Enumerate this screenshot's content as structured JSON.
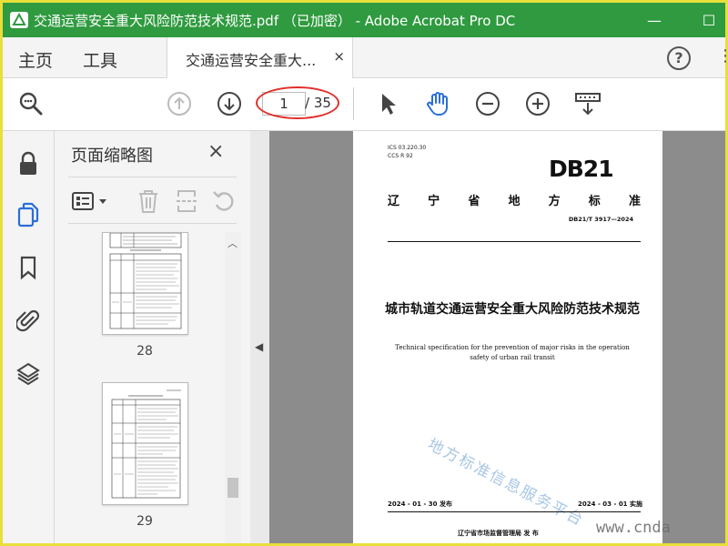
{
  "window": {
    "title": "交通运营安全重大风险防范技术规范.pdf （已加密） - Adobe Acrobat Pro DC",
    "minimize": "—",
    "maximize": "☐"
  },
  "menubar": {
    "home": "主页",
    "tools": "工具",
    "doc_tab": "交通运营安全重大...",
    "doc_tab_close": "×",
    "help": "?"
  },
  "toolbar": {
    "page_current": "1",
    "page_total": "/ 35"
  },
  "thumbnails": {
    "panel_title": "页面缩略图",
    "close": "×",
    "pages": [
      {
        "label": "28"
      },
      {
        "label": "29"
      }
    ]
  },
  "document": {
    "ics": "ICS  03.220.30",
    "ccs": "CCS  R 92",
    "logo": "DB21",
    "std_type_chars": [
      "辽",
      "宁",
      "省",
      "地",
      "方",
      "标",
      "准"
    ],
    "std_no": "DB21/T 3917—2024",
    "title_cn": "城市轨道交通运营安全重大风险防范技术规范",
    "title_en": "Technical specification for the prevention of major risks in the operation safety of urban rail transit",
    "release_date": "2024 - 01 - 30 发布",
    "impl_date": "2024 - 03 - 01 实施",
    "publisher": "辽宁省市场监督管理局     发  布",
    "watermark": "地方标准信息服务平台"
  },
  "site_watermark": "www.cnda",
  "colors": {
    "titlebar": "#2f9a3f",
    "accent": "#2a6ed8",
    "highlight": "#e0302a"
  }
}
